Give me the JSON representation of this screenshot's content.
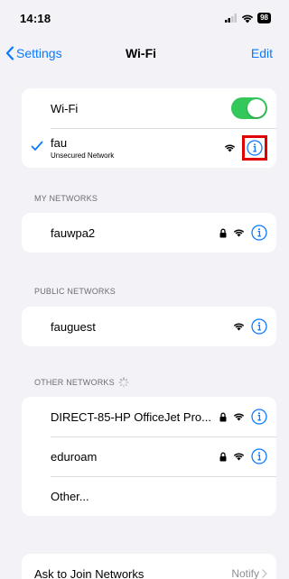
{
  "status_bar": {
    "time": "14:18",
    "battery": "98"
  },
  "nav": {
    "back_label": "Settings",
    "title": "Wi-Fi",
    "edit_label": "Edit"
  },
  "wifi_toggle": {
    "label": "Wi-Fi",
    "on": true
  },
  "connected": {
    "name": "fau",
    "subtitle": "Unsecured Network"
  },
  "my_networks": {
    "header": "MY NETWORKS",
    "items": [
      {
        "name": "fauwpa2",
        "locked": true
      }
    ]
  },
  "public_networks": {
    "header": "PUBLIC NETWORKS",
    "items": [
      {
        "name": "fauguest",
        "locked": false
      }
    ]
  },
  "other_networks": {
    "header": "OTHER NETWORKS",
    "items": [
      {
        "name": "DIRECT-85-HP OfficeJet Pro...",
        "locked": true
      },
      {
        "name": "eduroam",
        "locked": true
      }
    ],
    "other_label": "Other..."
  },
  "ask_to_join": {
    "label": "Ask to Join Networks",
    "value": "Notify"
  },
  "colors": {
    "accent": "#0a7aff",
    "toggle_on": "#34c759",
    "highlight": "#e00000",
    "background": "#f2f2f7"
  },
  "icons": [
    "chevron-left-icon",
    "wifi-icon",
    "lock-icon",
    "info-icon",
    "checkmark-icon",
    "spinner-icon",
    "signal-icon",
    "battery-icon",
    "chevron-right-icon"
  ]
}
